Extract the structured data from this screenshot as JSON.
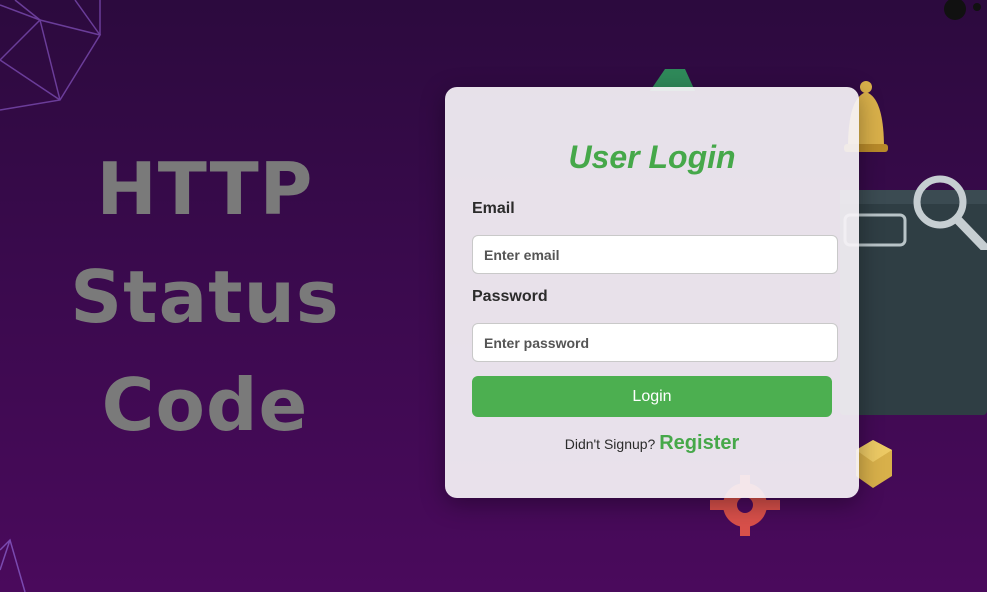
{
  "hero": {
    "lines": [
      "HTTP",
      "Status",
      "Code"
    ]
  },
  "login": {
    "title": "User Login",
    "email_label": "Email",
    "email_placeholder": "Enter email",
    "password_label": "Password",
    "password_placeholder": "Enter password",
    "login_button": "Login",
    "signup_prompt": "Didn't Signup?",
    "register_link": "Register"
  },
  "colors": {
    "accent": "#4caf50",
    "title": "#46a84a",
    "background_top": "#2c0a3e",
    "background_bottom": "#4a0a5c"
  }
}
